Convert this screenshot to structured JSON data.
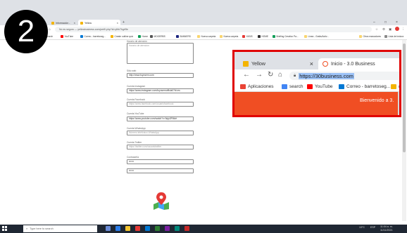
{
  "browser": {
    "tabs": [
      {
        "label": "Información - ",
        "active": false
      },
      {
        "label": "Yellow",
        "active": true
      }
    ],
    "omnibox_text": "No es seguro — yellowbusiness.com/perfil.php?id=yfhb7hgrf9e",
    "bookmarks": [
      {
        "label": "search",
        "color": "#4285f4"
      },
      {
        "label": "YouTube",
        "color": "#ff0000"
      },
      {
        "label": "Correo - barretoseg...",
        "color": "#0078d4"
      },
      {
        "label": "Create outline quiz",
        "color": "#f4b400"
      },
      {
        "label": "Home",
        "color": "#0f9d58"
      },
      {
        "label": "MOGERBS",
        "color": "#555555"
      },
      {
        "label": "BANNERS",
        "color": "#1a237e"
      },
      {
        "label": "Nueva carpeta",
        "color": "#f9d56e"
      },
      {
        "label": "Nueva carpeta",
        "color": "#f9d56e"
      },
      {
        "label": "YASIS",
        "color": "#e53935"
      },
      {
        "label": "HOME",
        "color": "#333333"
      },
      {
        "label": "Briefing Creativo Pa...",
        "color": "#0f9d58"
      },
      {
        "label": "Linea - Gratis/Activ...",
        "color": "#f9d56e"
      },
      {
        "label": "Otros marcadores",
        "color": "#f9d56e"
      },
      {
        "label": "Lista de lectura",
        "color": "#888888"
      }
    ]
  },
  "step_badge": "2",
  "form": {
    "fields": [
      {
        "label": "Horario de atención",
        "value": "Horario de atención",
        "placeholder": true,
        "type": "textarea"
      },
      {
        "label": "Sitio web",
        "value": "http://www.tuyosem.com",
        "placeholder": false
      },
      {
        "label": "Cuenta Instagram",
        "value": "https://www.instagram.com/tuyosemofficial/?hl=es",
        "placeholder": false
      },
      {
        "label": "Cuenta Facebook",
        "value": "https://www.facebook.com/usuariofacebook",
        "placeholder": true
      },
      {
        "label": "Cuenta YouTube",
        "value": "https://www.youtube.com/watch?v=9qlp3FMdrt",
        "placeholder": false
      },
      {
        "label": "Cuenta WhatsApp",
        "value": "Número telefónico WhatsApp",
        "placeholder": true
      },
      {
        "label": "Cuenta Twitter",
        "value": "https://twitter.com/usuariotwitter",
        "placeholder": true
      },
      {
        "label": "Contraseña",
        "value": "••••••",
        "placeholder": false
      },
      {
        "label": "",
        "value": "••••••",
        "placeholder": false
      }
    ]
  },
  "zoom": {
    "tabs": [
      {
        "label": "Yellow"
      },
      {
        "label": "Inicio - 3.0 Business"
      }
    ],
    "url": "https://30business.com",
    "bookmarks": [
      {
        "label": "Aplicaciones",
        "color": "#ea4335"
      },
      {
        "label": "search",
        "color": "#4285f4"
      },
      {
        "label": "YouTube",
        "color": "#ff0000"
      },
      {
        "label": "Correo - barretoseg...",
        "color": "#0078d4"
      },
      {
        "label": "(G",
        "color": "#f4b400"
      }
    ],
    "welcome": "Bienvenido a 3.",
    "accent": "#f04e23",
    "frame_color": "#e00000"
  },
  "taskbar": {
    "search_placeholder": "Type here to search",
    "tray_temp": "13°C",
    "tray_lang": "ESP",
    "tray_time": "11:04 a. m.",
    "tray_date": "11/11/2021"
  }
}
